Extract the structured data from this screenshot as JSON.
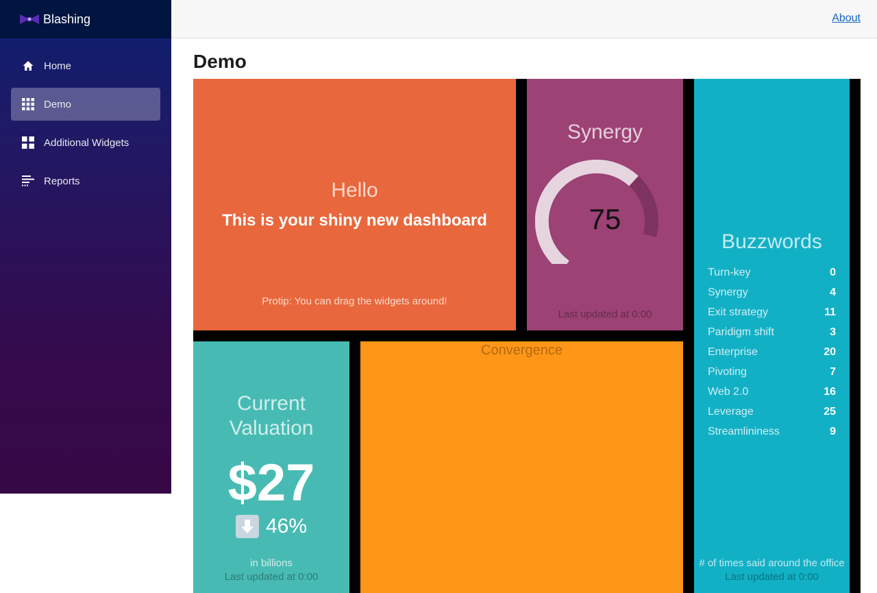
{
  "app": {
    "name": "Blashing"
  },
  "topbar": {
    "about_label": "About"
  },
  "sidebar": {
    "items": [
      {
        "label": "Home",
        "icon": "home-icon",
        "active": false
      },
      {
        "label": "Demo",
        "icon": "grid-icon",
        "active": true
      },
      {
        "label": "Additional Widgets",
        "icon": "widgets-icon",
        "active": false
      },
      {
        "label": "Reports",
        "icon": "reports-icon",
        "active": false
      }
    ]
  },
  "page": {
    "title": "Demo"
  },
  "widgets": {
    "hello": {
      "title": "Hello",
      "text": "This is your shiny new dashboard",
      "moreinfo": "Protip: You can drag the widgets around!",
      "color": "#e9673c"
    },
    "synergy": {
      "title": "Synergy",
      "value": "75",
      "max": 100,
      "updated": "Last updated at 0:00",
      "color": "#9c4274"
    },
    "buzzwords": {
      "title": "Buzzwords",
      "items": [
        {
          "label": "Turn-key",
          "value": "0"
        },
        {
          "label": "Synergy",
          "value": "4"
        },
        {
          "label": "Exit strategy",
          "value": "11"
        },
        {
          "label": "Paridigm shift",
          "value": "3"
        },
        {
          "label": "Enterprise",
          "value": "20"
        },
        {
          "label": "Pivoting",
          "value": "7"
        },
        {
          "label": "Web 2.0",
          "value": "16"
        },
        {
          "label": "Leverage",
          "value": "25"
        },
        {
          "label": "Streamlininess",
          "value": "9"
        }
      ],
      "moreinfo": "# of times said around the office",
      "updated": "Last updated at 0:00",
      "color": "#12b0c5"
    },
    "valuation": {
      "title": "Current Valuation",
      "value": "$27",
      "change": "46%",
      "change_icon": "arrow-down-icon",
      "moreinfo": "in billions",
      "updated": "Last updated at 0:00",
      "color": "#47bbb3"
    },
    "convergence": {
      "title": "Convergence",
      "color": "#ff9618"
    }
  }
}
